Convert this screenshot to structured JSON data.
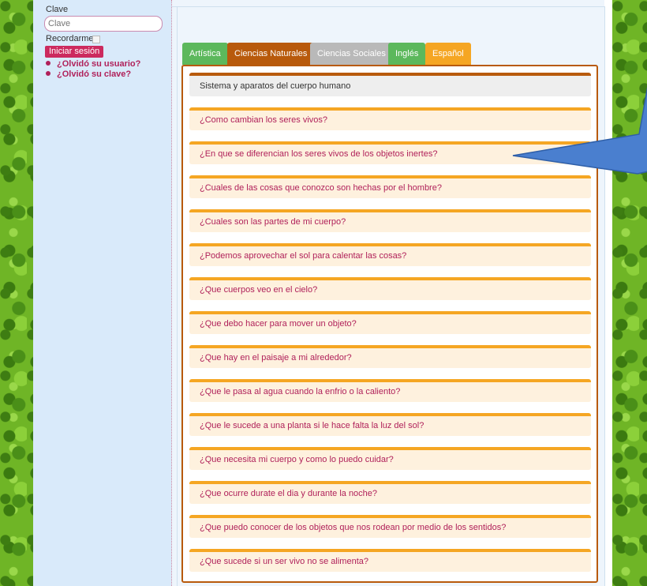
{
  "sidebar": {
    "clave_label": "Clave",
    "clave_placeholder": "Clave",
    "remember_label": "Recordarme",
    "login_button": "Iniciar sesión",
    "forgot_user": "¿Olvidó su usuario?",
    "forgot_pass": "¿Olvidó su clave?"
  },
  "tabs": [
    {
      "label": "Artística",
      "color": "#5cb85c"
    },
    {
      "label": "Ciencias Naturales",
      "color": "#b85a0c",
      "active": true
    },
    {
      "label": "Ciencias Sociales",
      "color": "#b9b9b9"
    },
    {
      "label": "Inglés",
      "color": "#5cb85c"
    },
    {
      "label": "Español",
      "color": "#f5a623"
    }
  ],
  "panel": {
    "header": "Sistema y aparatos del cuerpo humano",
    "topics": [
      "¿Como cambian los seres vivos?",
      "¿En que se diferencian los seres vivos de los objetos inertes?",
      "¿Cuales de las cosas que conozco son hechas por el hombre?",
      "¿Cuales son las partes de mi cuerpo?",
      "¿Podemos aprovechar el sol para calentar las cosas?",
      "¿Que cuerpos veo en el cielo?",
      "¿Que debo hacer para mover un objeto?",
      "¿Que hay en el paisaje a mi alrededor?",
      "¿Que le pasa al agua cuando la enfrio o la caliento?",
      "¿Que le sucede a una planta si le hace falta la luz del sol?",
      "¿Que necesita mi cuerpo y como lo puedo cuidar?",
      "¿Que ocurre durate el dia y durante la noche?",
      "¿Que puedo conocer de los objetos que nos rodean por medio de los sentidos?",
      "¿Que sucede si un ser vivo no se alimenta?"
    ]
  },
  "colors": {
    "accent_orange": "#f5a623",
    "active_tab_brown": "#b85a0c",
    "link_magenta": "#b0215a",
    "callout_blue": "#4a7fcf"
  }
}
